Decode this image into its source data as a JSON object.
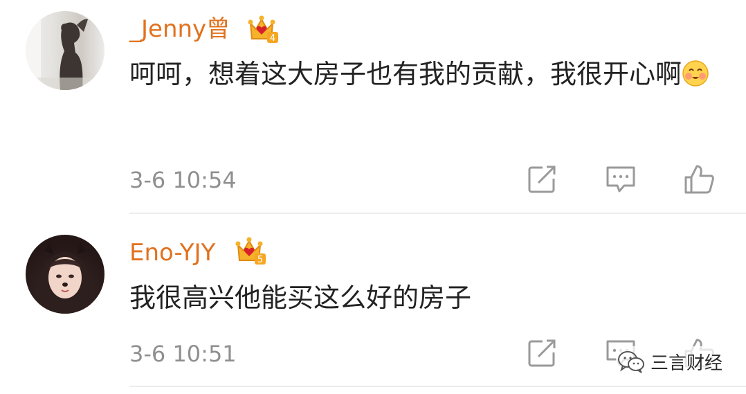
{
  "comments": [
    {
      "username": "_Jenny曾",
      "badge_level": "4",
      "text": "呵呵，想着这大房子也有我的贡献，我很开心啊",
      "emoji": "smiling-blush-emoji",
      "time": "3-6 10:54"
    },
    {
      "username": "Eno-YJY",
      "badge_level": "5",
      "text": "我很高兴他能买这么好的房子",
      "time": "3-6 10:51"
    }
  ],
  "watermark": {
    "text": "三言财经",
    "icon": "wechat-icon"
  },
  "colors": {
    "username": "#e1721f",
    "text": "#222222",
    "time": "#8f8f8f",
    "icon": "#9a9a9a",
    "badge": "#f5a623"
  }
}
